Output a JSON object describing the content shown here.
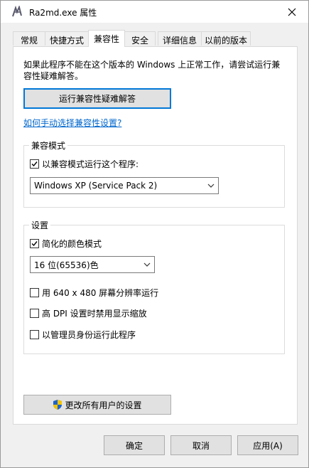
{
  "window": {
    "title": "Ra2md.exe 属性",
    "icon": "app-glyph-icon",
    "close_icon": "close-icon"
  },
  "tabs": [
    {
      "label": "常规"
    },
    {
      "label": "快捷方式"
    },
    {
      "label": "兼容性",
      "active": true
    },
    {
      "label": "安全"
    },
    {
      "label": "详细信息"
    },
    {
      "label": "以前的版本"
    }
  ],
  "compat": {
    "intro": "如果此程序不能在这个版本的 Windows 上正常工作，请尝试运行兼容性疑难解答。",
    "troubleshoot_button": "运行兼容性疑难解答",
    "manual_link": "如何手动选择兼容性设置?"
  },
  "compat_mode": {
    "group_title": "兼容模式",
    "checkbox_label": "以兼容模式运行这个程序:",
    "checked": true,
    "selected_os": "Windows XP (Service Pack 2)"
  },
  "settings": {
    "group_title": "设置",
    "reduced_color": {
      "label": "简化的颜色模式",
      "checked": true
    },
    "color_depth": "16 位(65536)色",
    "res_640": {
      "label": "用 640 x 480 屏幕分辨率运行",
      "checked": false
    },
    "high_dpi": {
      "label": "高 DPI 设置时禁用显示缩放",
      "checked": false
    },
    "run_admin": {
      "label": "以管理员身份运行此程序",
      "checked": false
    }
  },
  "all_users_button": "更改所有用户的设置",
  "footer": {
    "ok": "确定",
    "cancel": "取消",
    "apply": "应用(A)"
  },
  "colors": {
    "accent": "#0078d7",
    "link": "#0066cc",
    "button_face": "#e1e1e1"
  }
}
